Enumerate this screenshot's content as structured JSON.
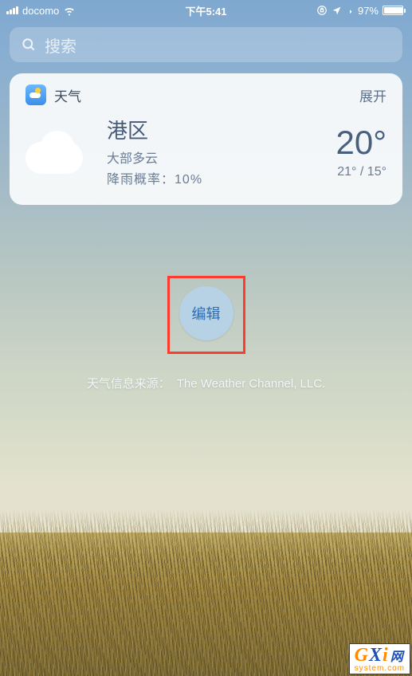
{
  "status": {
    "carrier": "docomo",
    "time": "下午5:41",
    "battery_percent": "97%"
  },
  "search": {
    "placeholder": "搜索"
  },
  "widget": {
    "app_title": "天气",
    "expand_label": "展开",
    "location": "港区",
    "condition": "大部多云",
    "rain_label": "降雨概率：",
    "rain_value": "10%",
    "temp_now": "20°",
    "temp_high": "21°",
    "temp_low": "15°"
  },
  "edit": {
    "label": "编辑"
  },
  "attribution": {
    "label": "天气信息来源：",
    "source": "The Weather Channel, LLC."
  },
  "watermark": {
    "brand_g": "G",
    "brand_x": "X",
    "brand_i": "i",
    "brand_net": "网",
    "domain": "system.com"
  }
}
